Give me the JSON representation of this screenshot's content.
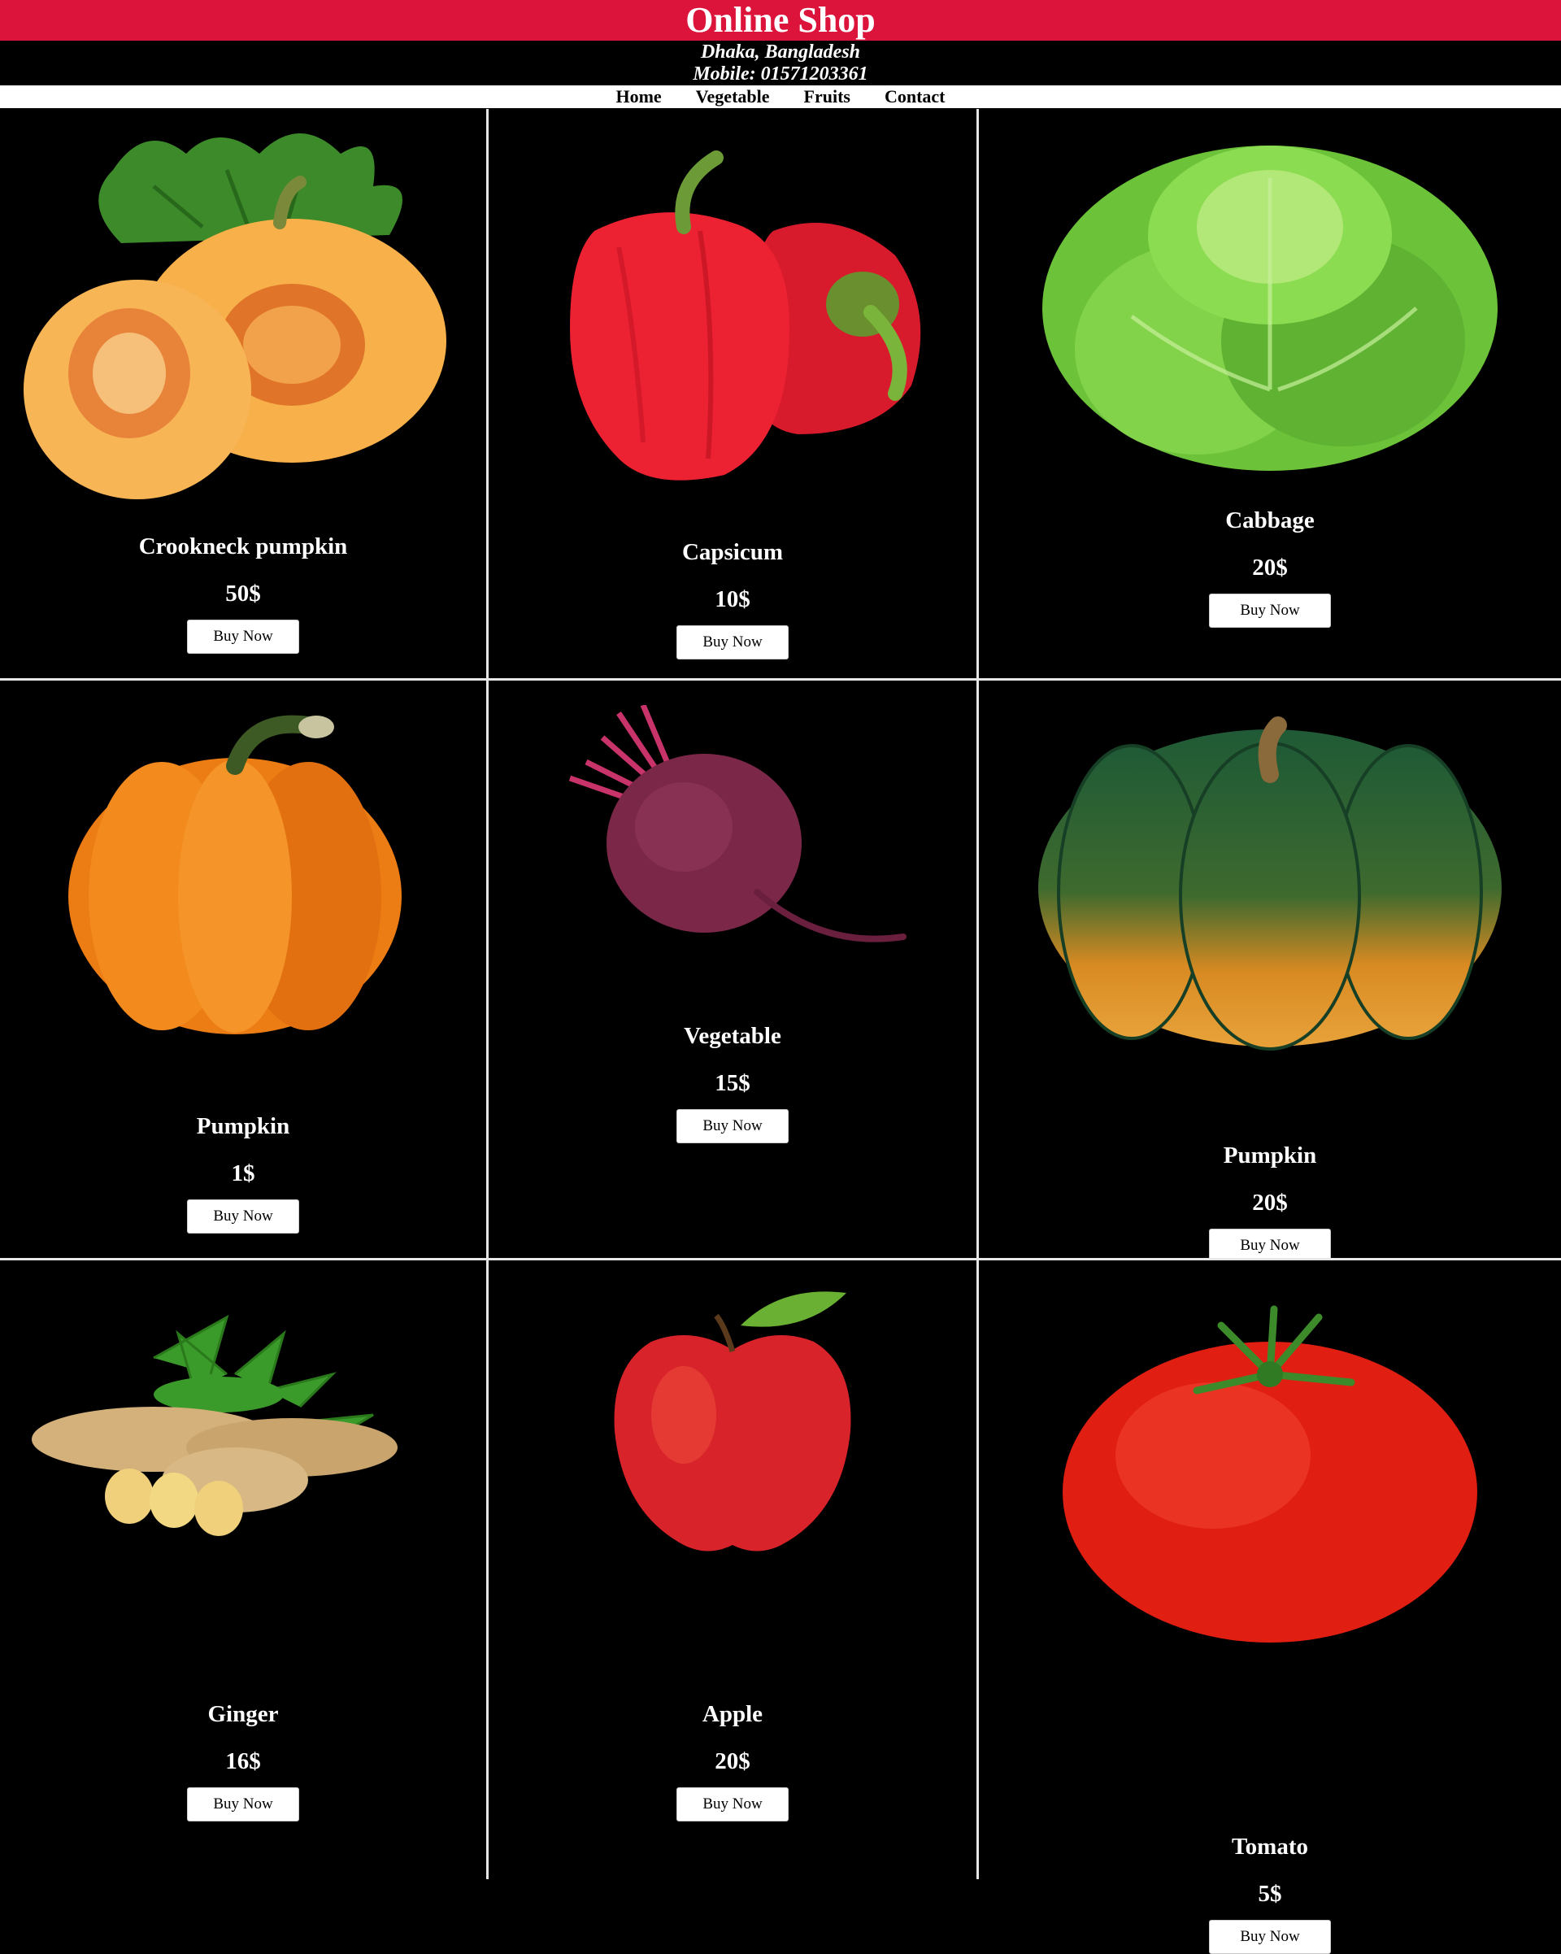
{
  "header": {
    "title": "Online Shop",
    "location": "Dhaka, Bangladesh",
    "mobile": "Mobile: 01571203361"
  },
  "nav": {
    "items": [
      "Home",
      "Vegetable",
      "Fruits",
      "Contact"
    ]
  },
  "products": [
    {
      "name": "Crookneck pumpkin",
      "price": "50$",
      "button": "Buy Now",
      "image": "butternut-squash-image"
    },
    {
      "name": "Capsicum",
      "price": "10$",
      "button": "Buy Now",
      "image": "red-bell-pepper-image"
    },
    {
      "name": "Cabbage",
      "price": "20$",
      "button": "Buy Now",
      "image": "lettuce-image"
    },
    {
      "name": "Pumpkin",
      "price": "1$",
      "button": "Buy Now",
      "image": "orange-pumpkin-image"
    },
    {
      "name": "Vegetable",
      "price": "15$",
      "button": "Buy Now",
      "image": "beetroot-image"
    },
    {
      "name": "Pumpkin",
      "price": "20$",
      "button": "Buy Now",
      "image": "green-pumpkin-image"
    },
    {
      "name": "Ginger",
      "price": "16$",
      "button": "Buy Now",
      "image": "ginger-image"
    },
    {
      "name": "Apple",
      "price": "20$",
      "button": "Buy Now",
      "image": "apple-image"
    },
    {
      "name": "Tomato",
      "price": "5$",
      "button": "Buy Now",
      "image": "tomato-image"
    }
  ],
  "colors": {
    "header_bg": "#dc143c",
    "page_bg": "#000000",
    "nav_bg": "#ffffff",
    "divider": "#e6e6e6"
  }
}
